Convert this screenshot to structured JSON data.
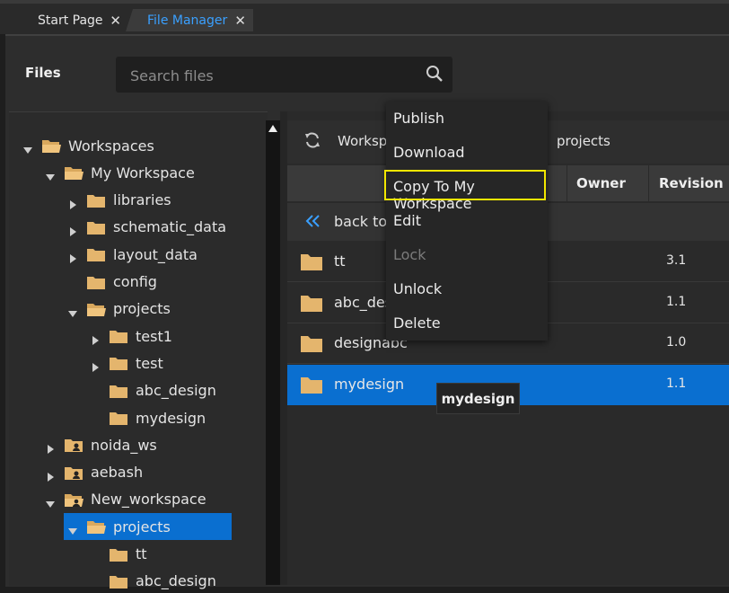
{
  "tabs": [
    {
      "label": "Start Page",
      "active": false
    },
    {
      "label": "File Manager",
      "active": true
    }
  ],
  "files_title": "Files",
  "search": {
    "placeholder": "Search files",
    "value": ""
  },
  "tree": {
    "items": [
      {
        "label": "Workspaces",
        "depth": 0,
        "state": "expanded",
        "icon": "folder-open-icon"
      },
      {
        "label": "My Workspace",
        "depth": 1,
        "state": "expanded",
        "icon": "folder-open-icon"
      },
      {
        "label": "libraries",
        "depth": 2,
        "state": "collapsed",
        "icon": "folder-icon"
      },
      {
        "label": "schematic_data",
        "depth": 2,
        "state": "collapsed",
        "icon": "folder-icon"
      },
      {
        "label": "layout_data",
        "depth": 2,
        "state": "collapsed",
        "icon": "folder-icon"
      },
      {
        "label": "config",
        "depth": 2,
        "state": "leaf",
        "icon": "folder-icon"
      },
      {
        "label": "projects",
        "depth": 2,
        "state": "expanded",
        "icon": "folder-open-icon"
      },
      {
        "label": "test1",
        "depth": 3,
        "state": "collapsed",
        "icon": "folder-icon"
      },
      {
        "label": "test",
        "depth": 3,
        "state": "collapsed",
        "icon": "folder-icon"
      },
      {
        "label": "abc_design",
        "depth": 3,
        "state": "leaf",
        "icon": "folder-icon"
      },
      {
        "label": "mydesign",
        "depth": 3,
        "state": "leaf",
        "icon": "folder-icon"
      },
      {
        "label": "noida_ws",
        "depth": 1,
        "state": "collapsed",
        "icon": "user-folder-icon"
      },
      {
        "label": "aebash",
        "depth": 1,
        "state": "collapsed",
        "icon": "user-folder-icon"
      },
      {
        "label": "New_workspace",
        "depth": 1,
        "state": "expanded",
        "icon": "user-folder-open-icon"
      },
      {
        "label": "projects",
        "depth": 2,
        "state": "expanded",
        "icon": "folder-open-icon",
        "selected": true
      },
      {
        "label": "tt",
        "depth": 3,
        "state": "leaf",
        "icon": "folder-icon"
      },
      {
        "label": "abc_design",
        "depth": 3,
        "state": "leaf",
        "icon": "folder-icon"
      }
    ]
  },
  "breadcrumb": {
    "first": "Workspa",
    "last": "projects"
  },
  "columns": {
    "owner": "Owner",
    "revision": "Revision"
  },
  "back_label": "back to p",
  "files": [
    {
      "name": "tt",
      "revision": "3.1",
      "selected": false
    },
    {
      "name": "abc_desi",
      "revision": "1.1",
      "selected": false
    },
    {
      "name": "designabc",
      "revision": "1.0",
      "selected": false
    },
    {
      "name": "mydesign",
      "revision": "1.1",
      "selected": true
    }
  ],
  "context_menu": {
    "items": [
      {
        "label": "Publish",
        "enabled": true
      },
      {
        "label": "Download",
        "enabled": true
      },
      {
        "label": "Copy To My Workspace",
        "enabled": true,
        "highlighted": true
      },
      {
        "label": "Edit",
        "enabled": true
      },
      {
        "label": "Lock",
        "enabled": false
      },
      {
        "label": "Unlock",
        "enabled": true
      },
      {
        "label": "Delete",
        "enabled": true
      }
    ]
  },
  "tooltip": "mydesign",
  "colors": {
    "accent": "#3aa0ff",
    "selection": "#0a6fd0",
    "highlight": "#f2e600",
    "folder": "#e4b56d"
  }
}
